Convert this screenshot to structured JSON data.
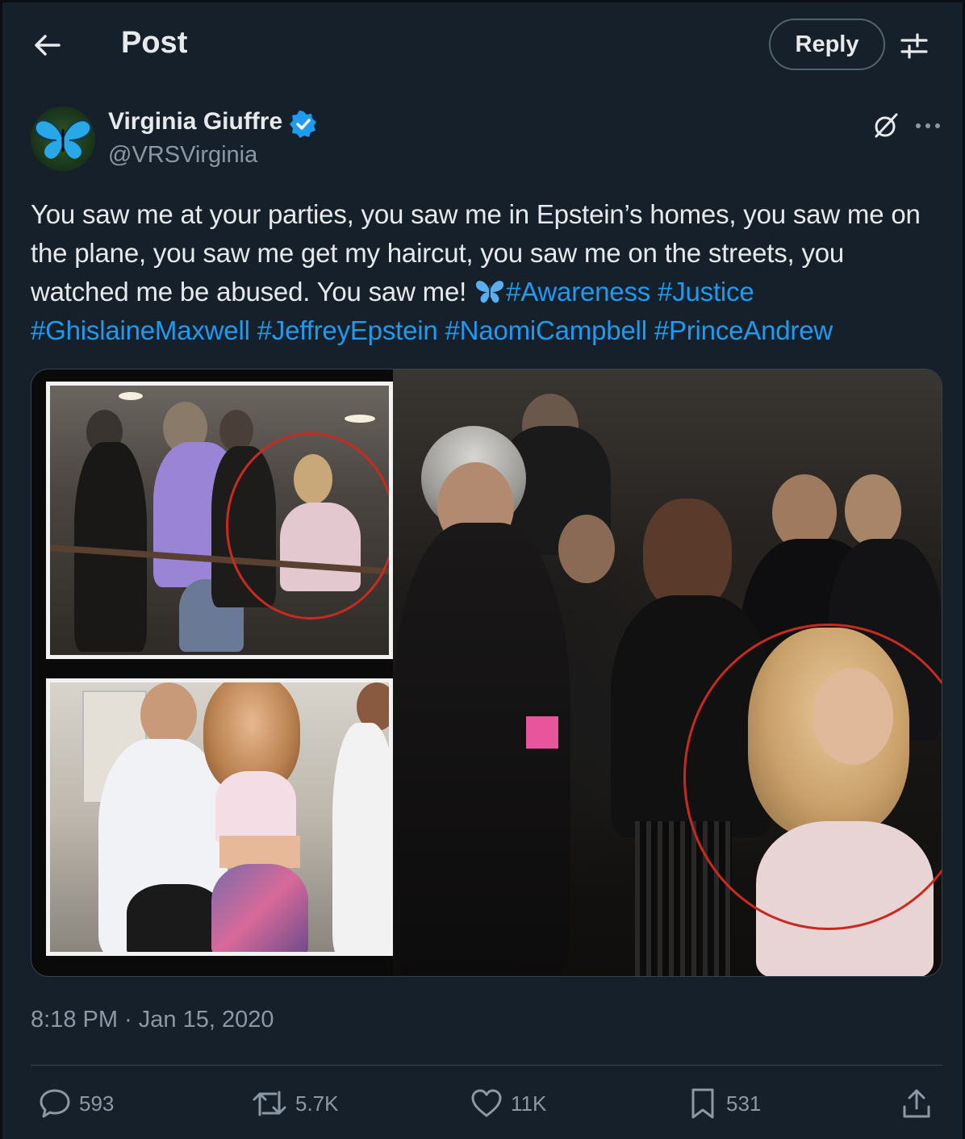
{
  "header": {
    "title": "Post",
    "reply_label": "Reply"
  },
  "author": {
    "name": "Virginia Giuffre",
    "handle": "@VRSVirginia",
    "verified": true
  },
  "post": {
    "text_main": "You saw me at your parties, you saw me in Epstein’s homes, you saw me on the plane, you saw me get my haircut, you saw me on the streets, you watched me be abused. You saw me! ",
    "hashtags": [
      "#Awareness",
      "#Justice",
      "#GhislaineMaxwell",
      "#JeffreyEpstein",
      "#NaomiCampbell",
      "#PrinceAndrew"
    ],
    "timestamp": "8:18 PM · Jan 15, 2020"
  },
  "actions": {
    "replies": "593",
    "reposts": "5.7K",
    "likes": "11K",
    "bookmarks": "531"
  },
  "icons": {
    "back": "arrow-left-icon",
    "filter": "sliders-icon",
    "grok": "grok-icon",
    "more": "more-horizontal-icon",
    "reply": "speech-bubble-icon",
    "repost": "repost-icon",
    "like": "heart-icon",
    "bookmark": "bookmark-icon",
    "share": "share-icon"
  },
  "colors": {
    "background": "#15202b",
    "accent": "#1d9bf0",
    "text": "#e7e9ea",
    "muted": "#8b98a5",
    "highlight_circle": "#c92a20"
  }
}
